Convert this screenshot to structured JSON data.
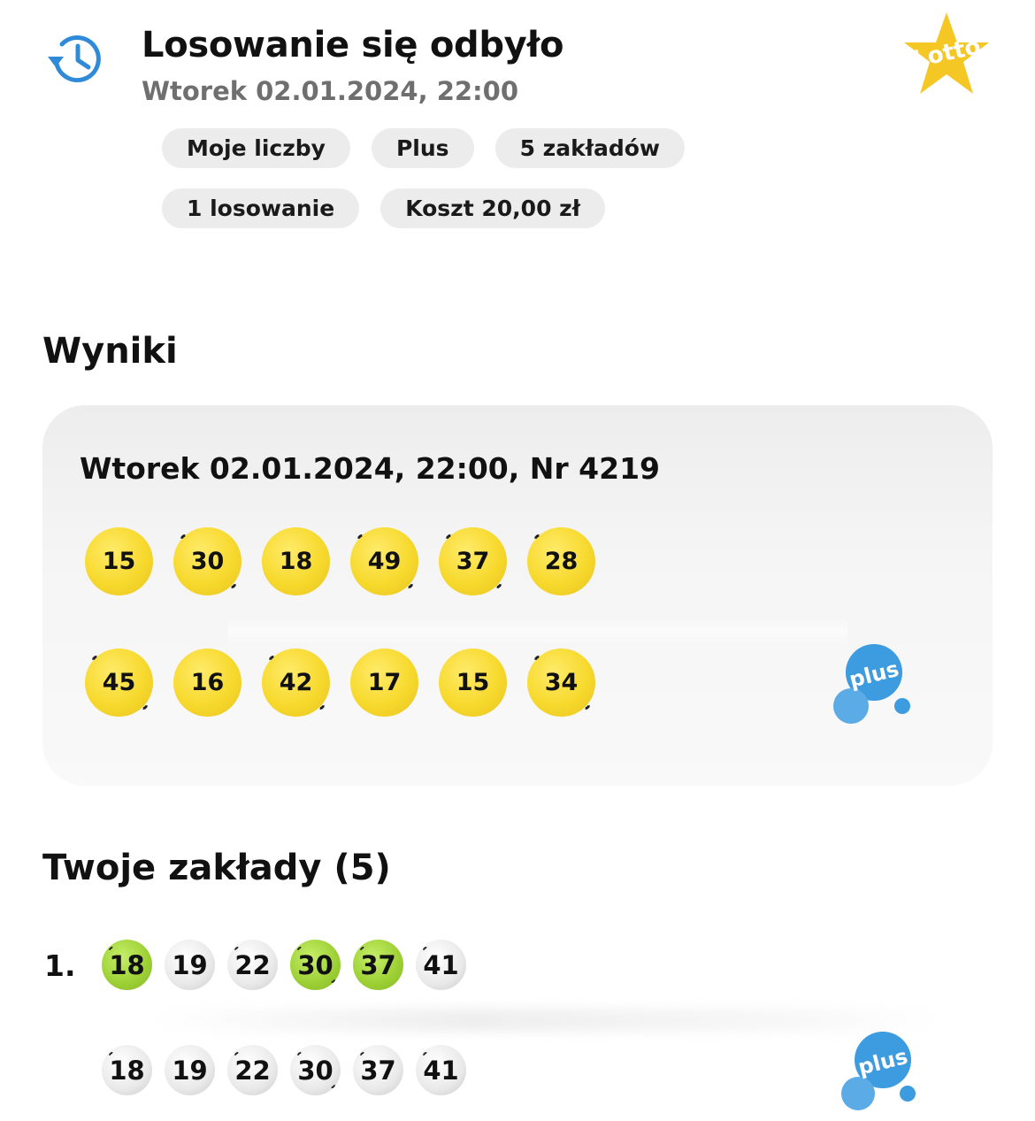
{
  "header": {
    "icon": "history-icon",
    "title": "Losowanie się odbyło",
    "subtitle": "Wtorek 02.01.2024, 22:00",
    "logo_text": "Lotto",
    "chips_row1": [
      "Moje liczby",
      "Plus",
      "5 zakładów"
    ],
    "chips_row2": [
      "1 losowanie",
      "Koszt 20,00 zł"
    ]
  },
  "results": {
    "section_title": "Wyniki",
    "draw_label": "Wtorek 02.01.2024, 22:00, Nr 4219",
    "lotto_numbers": [
      "15",
      "30",
      "18",
      "49",
      "37",
      "28"
    ],
    "plus_numbers": [
      "45",
      "16",
      "42",
      "17",
      "15",
      "34"
    ],
    "plus_logo_text": "plus"
  },
  "bets": {
    "section_title": "Twoje zakłady (5)",
    "items": [
      {
        "index": "1.",
        "numbers": [
          {
            "value": "18",
            "hit": true
          },
          {
            "value": "19",
            "hit": false
          },
          {
            "value": "22",
            "hit": false
          },
          {
            "value": "30",
            "hit": true
          },
          {
            "value": "37",
            "hit": true
          },
          {
            "value": "41",
            "hit": false
          }
        ],
        "plus_numbers": [
          "18",
          "19",
          "22",
          "30",
          "37",
          "41"
        ]
      }
    ]
  },
  "colors": {
    "ball_yellow": "#f7d92d",
    "ball_green": "#9ccf33",
    "ball_grey": "#e9e9e9",
    "accent_blue": "#2f8ad8",
    "plus_blue": "#3d9be0",
    "lotto_star": "#f5c724"
  }
}
